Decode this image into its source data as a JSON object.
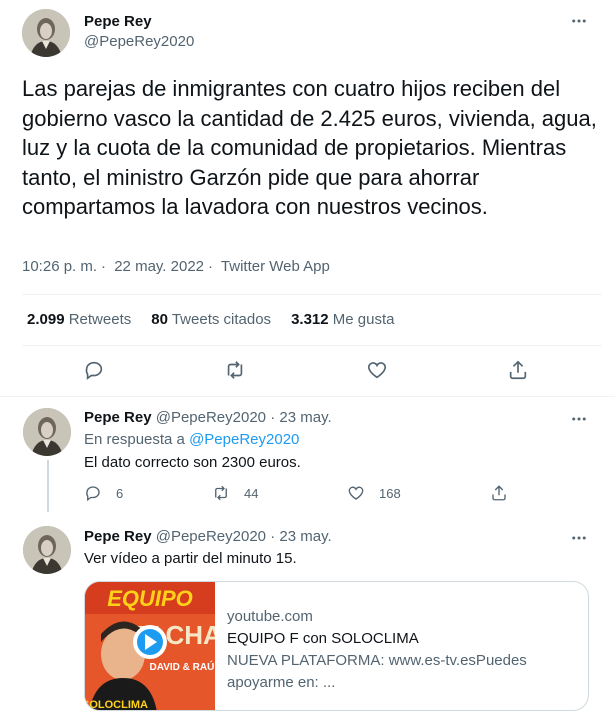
{
  "main_tweet": {
    "author_name": "Pepe Rey",
    "author_handle": "@PepeRey2020",
    "text": "Las parejas de inmigrantes con cuatro hijos reciben del gobierno vasco la cantidad de 2.425 euros, vivienda, agua, luz y la cuota de la comunidad de propietarios. Mientras tanto, el ministro Garzón pide que para ahorrar compartamos la lavadora con nuestros vecinos.",
    "time": "10:26 p. m.",
    "date": "22 may. 2022",
    "source": "Twitter Web App",
    "separator": "·",
    "stats": {
      "retweets_count": "2.099",
      "retweets_label": "Retweets",
      "quotes_count": "80",
      "quotes_label": "Tweets citados",
      "likes_count": "3.312",
      "likes_label": "Me gusta"
    }
  },
  "replies": [
    {
      "author_name": "Pepe Rey",
      "author_handle": "@PepeRey2020",
      "date": "23 may.",
      "in_reply_prefix": "En respuesta a",
      "in_reply_handle": "@PepeRey2020",
      "text": "El dato correcto son 2300 euros.",
      "reply_count": "6",
      "retweet_count": "44",
      "like_count": "168"
    },
    {
      "author_name": "Pepe Rey",
      "author_handle": "@PepeRey2020",
      "date": "23 may.",
      "text": "Ver vídeo a partir del minuto 15.",
      "card": {
        "domain": "youtube.com",
        "title": "EQUIPO F con SOLOCLIMA",
        "description_line1": "NUEVA PLATAFORMA: www.es-tv.esPuedes",
        "description_line2": "apoyarme en: ...",
        "thumb_top_text": "EQUIPO",
        "thumb_mid_text": "FACHA",
        "thumb_names": "DAVID & RAÚL",
        "thumb_bottom_text": "SOLOCLIMA"
      }
    }
  ],
  "colors": {
    "text_primary": "#0f1419",
    "text_secondary": "#536471",
    "link": "#1d9bf0",
    "divider": "#eff3f4"
  },
  "icons": [
    "more-icon",
    "reply-icon",
    "retweet-icon",
    "like-icon",
    "share-icon",
    "play-icon"
  ]
}
